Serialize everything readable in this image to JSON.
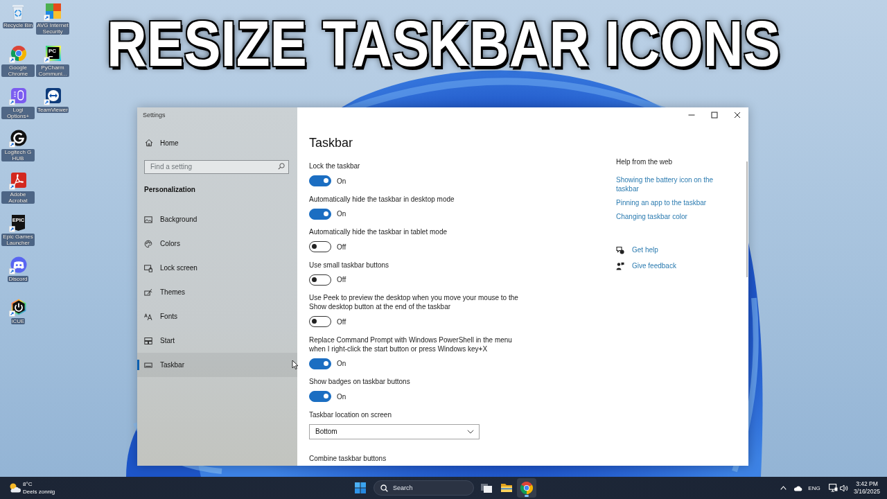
{
  "headline": "RESIZE TASKBAR ICONS",
  "desktop_icons": [
    {
      "label": "Recycle Bin"
    },
    {
      "label": "Google Chrome"
    },
    {
      "label": "Logi Options+"
    },
    {
      "label": "Logitech G HUB"
    },
    {
      "label": "Adobe Acrobat"
    },
    {
      "label": "Epic Games Launcher",
      "logo_text": "EPIC"
    },
    {
      "label": "Discord"
    },
    {
      "label": "iCUE"
    },
    {
      "label": "AVG Internet Security"
    },
    {
      "label": "PyCharm Communi...",
      "logo_text": "PC"
    },
    {
      "label": "TeamViewer"
    }
  ],
  "window": {
    "title": "Settings"
  },
  "sidebar": {
    "home": "Home",
    "search": {
      "placeholder": "Find a setting"
    },
    "section": "Personalization",
    "items": [
      {
        "label": "Background",
        "selected": false
      },
      {
        "label": "Colors",
        "selected": false
      },
      {
        "label": "Lock screen",
        "selected": false
      },
      {
        "label": "Themes",
        "selected": false
      },
      {
        "label": "Fonts",
        "selected": false
      },
      {
        "label": "Start",
        "selected": false
      },
      {
        "label": "Taskbar",
        "selected": true
      }
    ]
  },
  "page": {
    "title": "Taskbar",
    "settings": [
      {
        "kind": "toggle",
        "label": "Lock the taskbar",
        "on": true,
        "state_label": "On"
      },
      {
        "kind": "toggle",
        "label": "Automatically hide the taskbar in desktop mode",
        "on": true,
        "state_label": "On"
      },
      {
        "kind": "toggle",
        "label": "Automatically hide the taskbar in tablet mode",
        "on": false,
        "state_label": "Off"
      },
      {
        "kind": "toggle",
        "label": "Use small taskbar buttons",
        "on": false,
        "state_label": "Off"
      },
      {
        "kind": "toggle",
        "label": "Use Peek to preview the desktop when you move your mouse to the Show desktop button at the end of the taskbar",
        "on": false,
        "state_label": "Off"
      },
      {
        "kind": "toggle",
        "label": "Replace Command Prompt with Windows PowerShell in the menu when I right-click the start button or press Windows key+X",
        "on": true,
        "state_label": "On"
      },
      {
        "kind": "toggle",
        "label": "Show badges on taskbar buttons",
        "on": true,
        "state_label": "On"
      },
      {
        "kind": "dropdown",
        "label": "Taskbar location on screen",
        "value": "Bottom"
      },
      {
        "kind": "label",
        "label": "Combine taskbar buttons"
      }
    ]
  },
  "help": {
    "heading": "Help from the web",
    "links": [
      "Showing the battery icon on the taskbar",
      "Pinning an app to the taskbar",
      "Changing taskbar color"
    ],
    "support": [
      {
        "label": "Get help"
      },
      {
        "label": "Give feedback"
      }
    ]
  },
  "taskbar": {
    "weather": {
      "temperature": "8°C",
      "condition": "Deels zonnig"
    },
    "search": {
      "placeholder": "Search"
    },
    "apps": [
      {
        "active": false
      },
      {
        "active": false
      },
      {
        "active": true
      }
    ],
    "language": "ENG",
    "time": "3:42 PM",
    "date": "3/16/2025"
  }
}
